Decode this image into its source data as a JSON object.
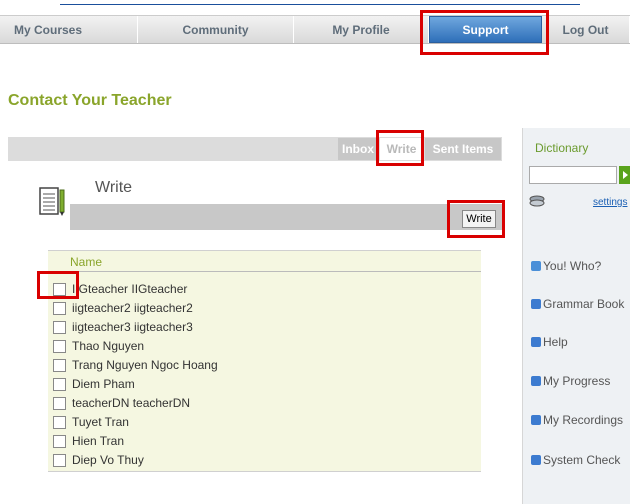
{
  "nav": {
    "items": [
      "My Courses",
      "Community",
      "My Profile",
      "Support",
      "Log Out"
    ],
    "active": "Support"
  },
  "page_title": "Contact Your Teacher",
  "mail_tabs": [
    "Inbox",
    "Write",
    "Sent Items"
  ],
  "write_section": {
    "heading": "Write",
    "button_label": "Write"
  },
  "recipients": {
    "column_header": "Name",
    "rows": [
      "IIGteacher IIGteacher",
      "iigteacher2 iigteacher2",
      "iigteacher3 iigteacher3",
      "Thao Nguyen",
      "Trang Nguyen Ngoc Hoang",
      "Diem Pham",
      "teacherDN teacherDN",
      "Tuyet Tran",
      "Hien Tran",
      "Diep Vo Thuy"
    ]
  },
  "sidebar": {
    "title": "Dictionary",
    "settings_link": "settings",
    "links": [
      "You! Who?",
      "Grammar Book",
      "Help",
      "My Progress",
      "My Recordings",
      "System Check"
    ]
  },
  "colors": {
    "accent_green": "#8aa52b",
    "nav_active_blue": "#2e6fb9",
    "highlight_red": "#d90000",
    "recipient_bg": "#f5f7e1"
  },
  "icons": {
    "write": "notepad-pen-icon",
    "dictionary_go": "arrow-right-icon",
    "dictionary_book": "book-stack-icon",
    "links": [
      "speech-bubble-icon",
      "book-icon",
      "question-icon",
      "chart-icon",
      "recording-icon",
      "download-icon"
    ]
  }
}
